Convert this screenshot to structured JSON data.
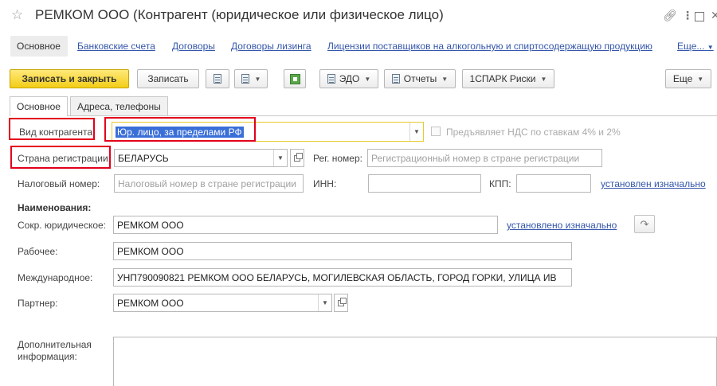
{
  "window": {
    "title": "РЕМКОМ ООО (Контрагент (юридическое или физическое лицо)"
  },
  "nav": {
    "items": [
      "Основное",
      "Банковские счета",
      "Договоры",
      "Договоры лизинга",
      "Лицензии поставщиков на алкогольную и спиртосодержащую продукцию",
      "Еще..."
    ]
  },
  "toolbar": {
    "save_close": "Записать и закрыть",
    "save": "Записать",
    "edo": "ЭДО",
    "reports": "Отчеты",
    "spark": "1СПАРК Риски",
    "more": "Еще"
  },
  "tabs": [
    "Основное",
    "Адреса, телефоны"
  ],
  "form": {
    "kind_label": "Вид контрагента",
    "kind_value": "Юр. лицо, за пределами РФ",
    "vat_label": "Предъявляет НДС по ставкам 4% и 2%",
    "country_label": "Страна регистрации:",
    "country_value": "БЕЛАРУСЬ",
    "reg_label": "Рег. номер:",
    "reg_placeholder": "Регистрационный номер в стране регистрации",
    "tax_label": "Налоговый номер:",
    "tax_placeholder": "Налоговый номер в стране регистрации",
    "inn_label": "ИНН:",
    "kpp_label": "КПП:",
    "kpp_link": "установлен изначально",
    "names_heading": "Наименования:",
    "short_label": "Сокр. юридическое:",
    "short_value": "РЕМКОМ ООО",
    "short_link": "установлено изначально",
    "work_label": "Рабочее:",
    "work_value": "РЕМКОМ ООО",
    "intl_label": "Международное:",
    "intl_value": "УНП790090821 РЕМКОМ ООО БЕЛАРУСЬ, МОГИЛЕВСКАЯ ОБЛАСТЬ, ГОРОД ГОРКИ, УЛИЦА ИВ",
    "partner_label": "Партнер:",
    "partner_value": "РЕМКОМ ООО",
    "extra_label_1": "Дополнительная",
    "extra_label_2": "информация:"
  },
  "icons": {
    "star": "star-icon",
    "link": "link-icon",
    "more": "more-vertical-icon",
    "maximize": "maximize-icon",
    "close": "close-icon"
  },
  "colors": {
    "primary_button": "#f3cd17",
    "link": "#3355aa",
    "highlight_box": "#e3001b",
    "selection": "#3a6fd8"
  }
}
